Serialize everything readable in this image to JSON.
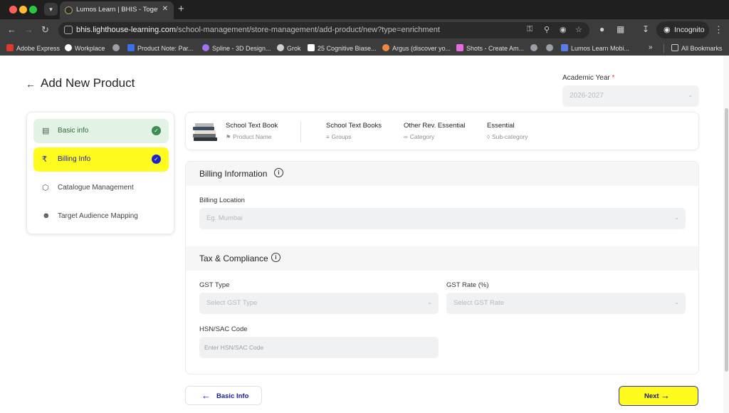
{
  "browser": {
    "tab_title": "Lumos Learn | BHIS - Togeth",
    "url_host": "bhis.lighthouse-learning.com",
    "url_path": "/school-management/store-management/add-product/new?type=enrichment",
    "incognito_label": "Incognito",
    "bookmarks": [
      {
        "label": "Adobe Express",
        "color": "#e0382f"
      },
      {
        "label": "Workplace",
        "color": "#ffffff"
      },
      {
        "label": "",
        "color": "#9aa0a6"
      },
      {
        "label": "Product Note: Par...",
        "color": "#3d6fe8"
      },
      {
        "label": "Spline - 3D Design...",
        "color": "#a471f0"
      },
      {
        "label": "Grok",
        "color": "#d0d0d0"
      },
      {
        "label": "25 Cognitive Biase...",
        "color": "#ffffff"
      },
      {
        "label": "Argus (discover yo...",
        "color": "#f0883e"
      },
      {
        "label": "Shots - Create Am...",
        "color": "#e86ae0"
      },
      {
        "label": "",
        "color": "#9aa0a6"
      },
      {
        "label": "",
        "color": "#9aa0a6"
      },
      {
        "label": "Lumos Learn Mobi...",
        "color": "#5b7be8"
      }
    ],
    "all_bookmarks": "All Bookmarks"
  },
  "header": {
    "title": "Add New Product",
    "academic_year_label": "Academic Year",
    "academic_year_required": "*",
    "academic_year_value": "2026-2027"
  },
  "steps": [
    {
      "label": "Basic info",
      "status": "complete"
    },
    {
      "label": "Billing Info",
      "status": "active"
    },
    {
      "label": "Catalogue Management",
      "status": "pending"
    },
    {
      "label": "Target Audience Mapping",
      "status": "pending"
    }
  ],
  "product_summary": {
    "product_name": {
      "value": "School Text Book",
      "key": "Product Name"
    },
    "groups": {
      "value": "School Text Books",
      "key": "Groups"
    },
    "category": {
      "value": "Other Rev. Essential",
      "key": "Category"
    },
    "sub_category": {
      "value": "Essential",
      "key": "Sub-category"
    }
  },
  "billing": {
    "section_title": "Billing Information",
    "location_label": "Billing Location",
    "location_placeholder": "Eg. Mumbai"
  },
  "tax": {
    "section_title": "Tax & Compliance",
    "gst_type_label": "GST Type",
    "gst_type_placeholder": "Select GST Type",
    "gst_rate_label": "GST Rate (%)",
    "gst_rate_placeholder": "Select GST Rate",
    "hsn_label": "HSN/SAC Code",
    "hsn_placeholder": "Enter HSN/SAC Code"
  },
  "footer": {
    "back_label": "Basic Info",
    "next_label": "Next"
  },
  "colors": {
    "accent_yellow": "#fffb1f",
    "accent_blue": "#1a1aa8",
    "complete_green": "#3c8f4f"
  }
}
